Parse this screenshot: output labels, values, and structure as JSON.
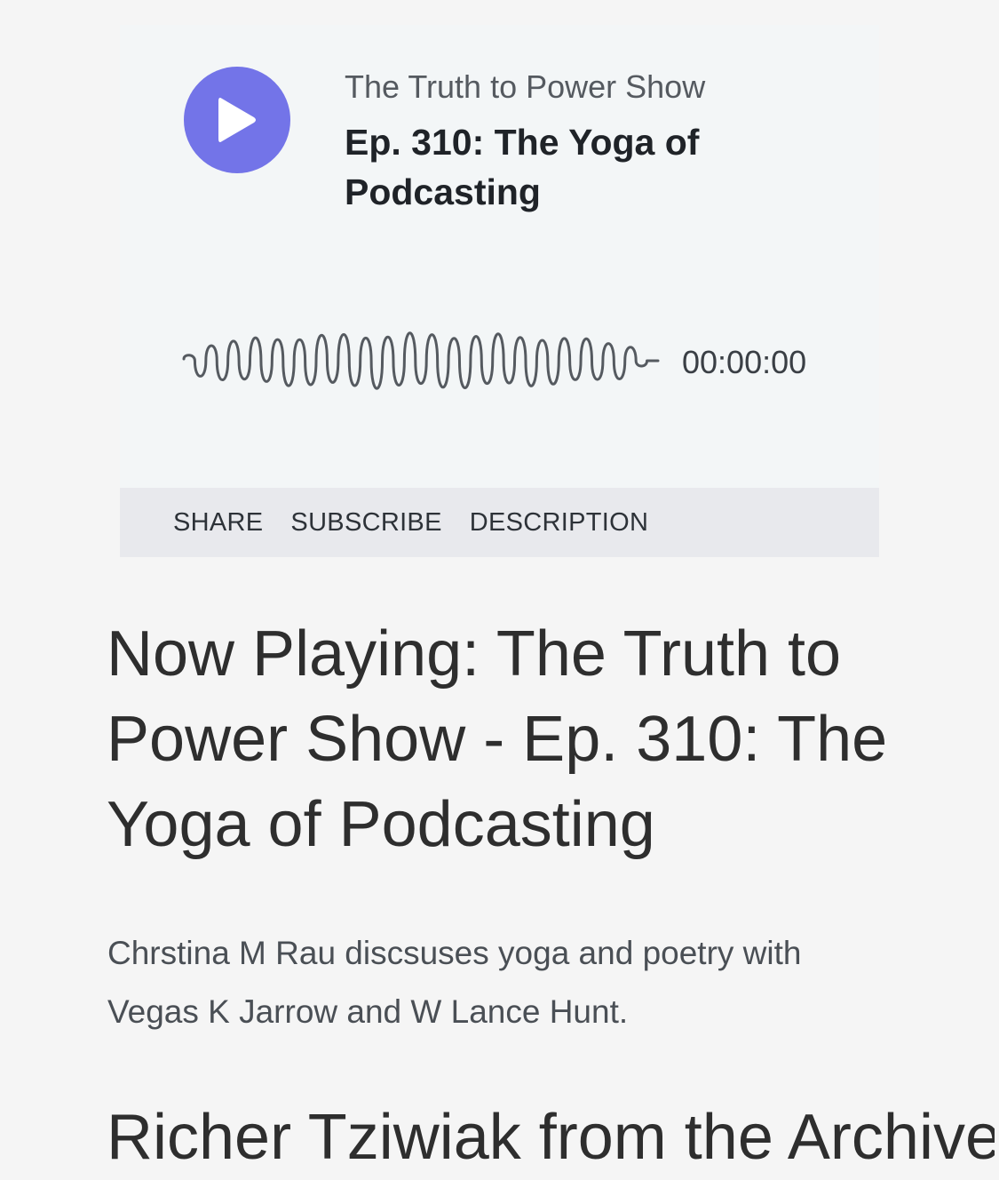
{
  "player": {
    "show_name": "The Truth to Power Show",
    "episode_title": "Ep. 310: The Yoga of Podcasting",
    "time": "00:00:00",
    "play_icon": "play-icon",
    "accent_color": "#7374e8",
    "progress": 0,
    "tabs": [
      {
        "label": "SHARE"
      },
      {
        "label": "SUBSCRIBE"
      },
      {
        "label": "DESCRIPTION"
      }
    ]
  },
  "article": {
    "heading": "Now Playing: The Truth to Power Show - Ep. 310: The Yoga of Podcasting",
    "description": "Chrstina M Rau discsuses yoga and poetry with Vegas K Jarrow and W Lance Hunt.",
    "next_heading": "Richer Tziwiak from the Archive"
  }
}
